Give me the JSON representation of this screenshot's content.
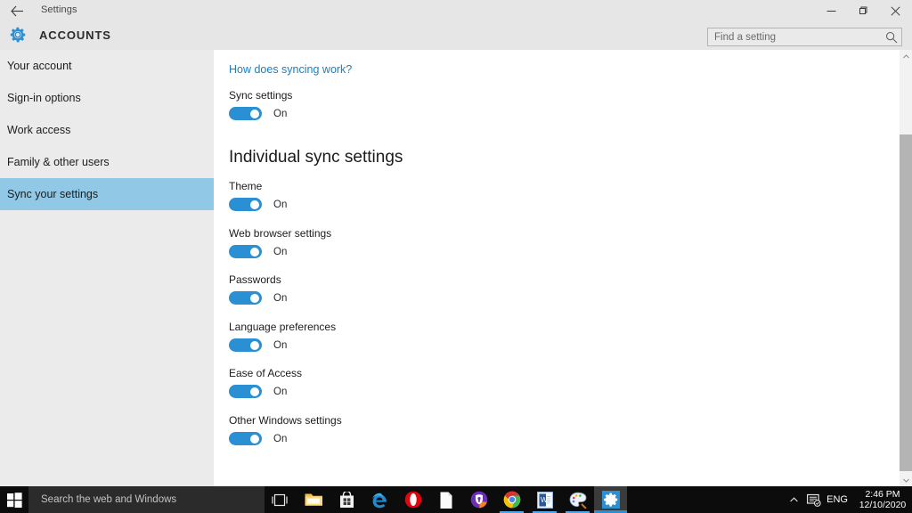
{
  "window": {
    "titlebar_label": "Settings",
    "back_icon": "back-arrow-icon",
    "controls": {
      "minimize": "minimize-icon",
      "restore": "restore-icon",
      "close": "close-icon"
    }
  },
  "header": {
    "gear_icon": "gear-icon",
    "title": "ACCOUNTS",
    "accent_color": "#2b8fd4"
  },
  "search": {
    "placeholder": "Find a setting",
    "value": "",
    "icon": "search-icon"
  },
  "sidebar": {
    "selected_index": 4,
    "highlight_color": "#90c8e6",
    "items": [
      {
        "label": "Your account"
      },
      {
        "label": "Sign-in options"
      },
      {
        "label": "Work access"
      },
      {
        "label": "Family & other users"
      },
      {
        "label": "Sync your settings"
      }
    ]
  },
  "content": {
    "help_link": "How does syncing work?",
    "master": {
      "label": "Sync settings",
      "state": "On"
    },
    "section_heading": "Individual sync settings",
    "items": [
      {
        "label": "Theme",
        "state": "On"
      },
      {
        "label": "Web browser settings",
        "state": "On"
      },
      {
        "label": "Passwords",
        "state": "On"
      },
      {
        "label": "Language preferences",
        "state": "On"
      },
      {
        "label": "Ease of Access",
        "state": "On"
      },
      {
        "label": "Other Windows settings",
        "state": "On"
      }
    ],
    "toggle_on_color": "#2b8fd4"
  },
  "scrollbar": {
    "up_arrow": "chevron-up-icon",
    "down_arrow": "chevron-down-icon"
  },
  "taskbar": {
    "start_icon": "windows-start-icon",
    "search_placeholder": "Search the web and Windows",
    "taskview_icon": "task-view-icon",
    "apps": [
      {
        "name": "file-explorer",
        "icon": "folder-icon"
      },
      {
        "name": "microsoft-store",
        "icon": "store-bag-icon"
      },
      {
        "name": "microsoft-edge",
        "icon": "edge-e-icon"
      },
      {
        "name": "opera-browser",
        "icon": "opera-o-icon"
      },
      {
        "name": "document-app",
        "icon": "page-icon"
      },
      {
        "name": "avast-secure-browser",
        "icon": "shield-browser-icon"
      },
      {
        "name": "google-chrome",
        "icon": "chrome-icon"
      },
      {
        "name": "word-document",
        "icon": "word-doc-icon"
      },
      {
        "name": "paint",
        "icon": "paint-palette-icon"
      },
      {
        "name": "settings",
        "icon": "gear-icon"
      }
    ],
    "tray": {
      "chevron": "chevron-up-icon",
      "ime_icon": "ime-notification-icon",
      "language": "ENG",
      "time": "2:46 PM",
      "date": "12/10/2020"
    }
  }
}
